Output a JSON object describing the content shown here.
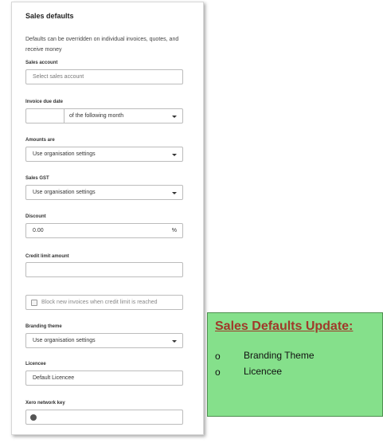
{
  "panel": {
    "title": "Sales defaults",
    "description": "Defaults can be overridden on individual invoices, quotes, and receive money",
    "sales_account": {
      "label": "Sales account",
      "placeholder": "Select sales account"
    },
    "invoice_due_date": {
      "label": "Invoice due date",
      "day_value": "",
      "option": "of the following month"
    },
    "amounts_are": {
      "label": "Amounts are",
      "value": "Use organisation settings"
    },
    "sales_gst": {
      "label": "Sales GST",
      "value": "Use organisation settings"
    },
    "discount": {
      "label": "Discount",
      "value": "0.00",
      "unit": "%"
    },
    "credit_limit": {
      "label": "Credit limit amount",
      "value": ""
    },
    "block_invoices": {
      "label": "Block new invoices when credit limit is reached",
      "checked": false
    },
    "branding_theme": {
      "label": "Branding theme",
      "value": "Use organisation settings"
    },
    "licencee": {
      "label": "Licencee",
      "value": "Default Licencee"
    },
    "xero_network_key": {
      "label": "Xero network key",
      "value": ""
    }
  },
  "note": {
    "title": "Sales Defaults Update:",
    "items": [
      {
        "bullet": "o",
        "text": "Branding Theme"
      },
      {
        "bullet": "o",
        "text": "Licencee"
      }
    ],
    "background": "#85e08b",
    "title_color": "#a0392a"
  }
}
